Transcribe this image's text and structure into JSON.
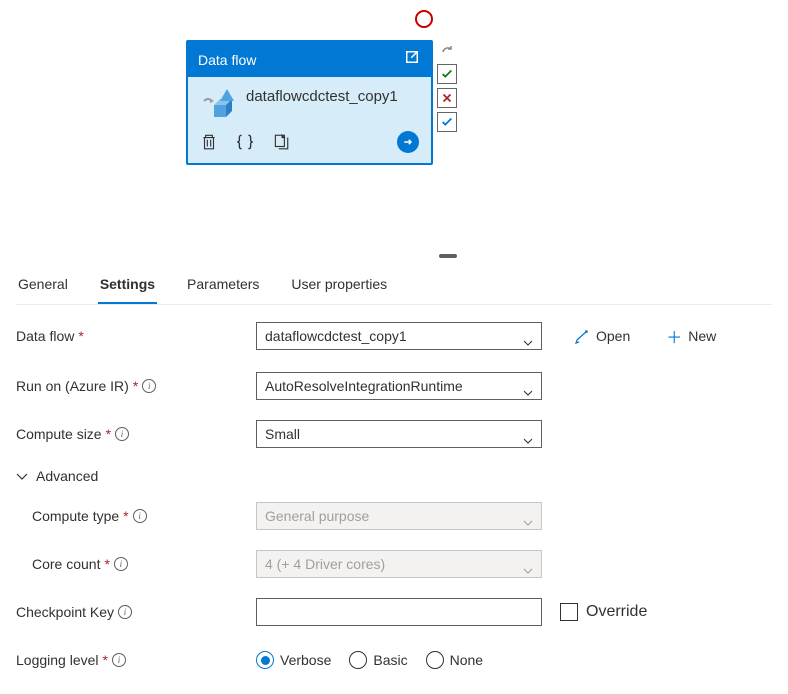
{
  "activity": {
    "header_title": "Data flow",
    "name": "dataflowcdctest_copy1"
  },
  "tabs": {
    "general": "General",
    "settings": "Settings",
    "parameters": "Parameters",
    "user_properties": "User properties",
    "active": "settings"
  },
  "form": {
    "dataflow_label": "Data flow",
    "dataflow_value": "dataflowcdctest_copy1",
    "open_label": "Open",
    "new_label": "New",
    "runon_label": "Run on (Azure IR)",
    "runon_value": "AutoResolveIntegrationRuntime",
    "compute_size_label": "Compute size",
    "compute_size_value": "Small",
    "advanced_label": "Advanced",
    "compute_type_label": "Compute type",
    "compute_type_value": "General purpose",
    "core_count_label": "Core count",
    "core_count_value": "4 (+ 4 Driver cores)",
    "checkpoint_key_label": "Checkpoint Key",
    "checkpoint_key_value": "",
    "override_label": "Override",
    "logging_level_label": "Logging level",
    "logging": {
      "verbose": "Verbose",
      "basic": "Basic",
      "none": "None",
      "selected": "verbose"
    }
  }
}
